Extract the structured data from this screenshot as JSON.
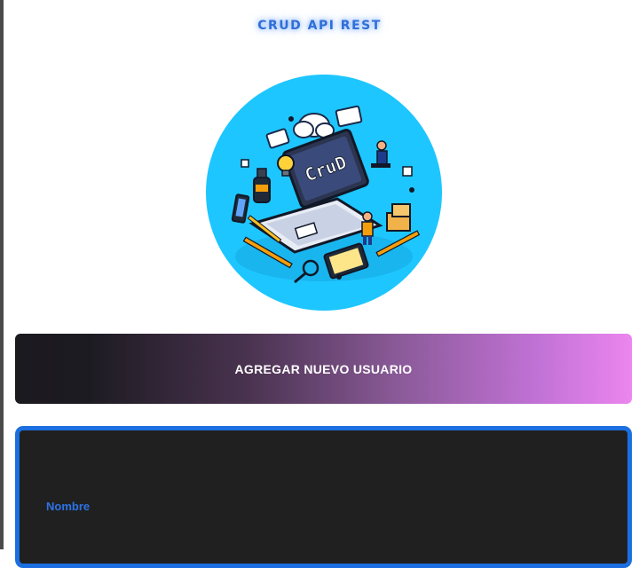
{
  "header": {
    "title": "CRUD API REST"
  },
  "logo": {
    "text": "CruD",
    "background": "#1ec6ff"
  },
  "add_user": {
    "label": "AGREGAR NUEVO USUARIO"
  },
  "form": {
    "fields": [
      {
        "label": "Nombre"
      }
    ],
    "border_color": "#1b6fe0",
    "label_color": "#2c73e6"
  }
}
